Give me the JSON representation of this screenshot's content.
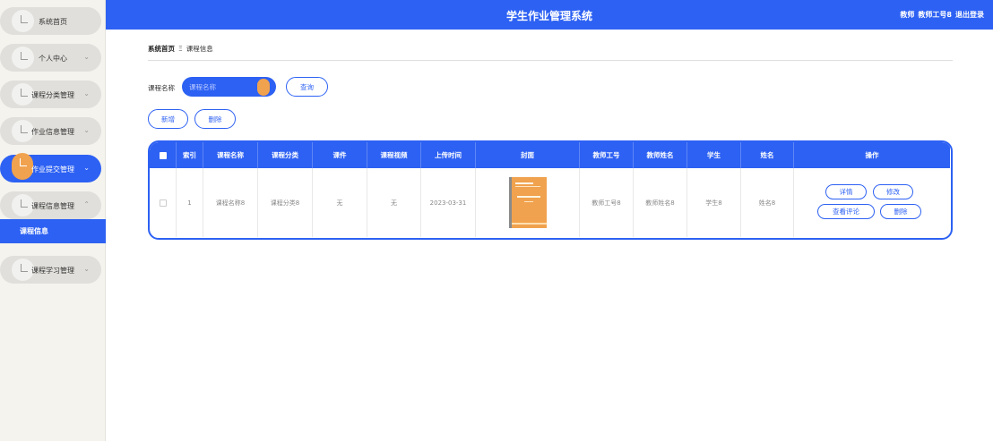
{
  "header": {
    "title": "学生作业管理系统",
    "user_role": "教师",
    "user_name": "教师工号8",
    "logout": "退出登录"
  },
  "sidebar": {
    "items": [
      {
        "label": "系统首页"
      },
      {
        "label": "个人中心"
      },
      {
        "label": "课程分类管理"
      },
      {
        "label": "作业信息管理"
      },
      {
        "label": "作业提交管理"
      },
      {
        "label": "课程信息管理"
      },
      {
        "label": "课程学习管理"
      }
    ],
    "sub_item": "课程信息"
  },
  "breadcrumb": {
    "home": "系统首页",
    "separator": "Ξ",
    "current": "课程信息"
  },
  "search": {
    "label": "课程名称",
    "placeholder": "课程名称",
    "button": "查询"
  },
  "actions": {
    "add": "新增",
    "delete": "删除"
  },
  "table": {
    "headers": [
      "索引",
      "课程名称",
      "课程分类",
      "课件",
      "课程视频",
      "上传时间",
      "封面",
      "教师工号",
      "教师姓名",
      "学生",
      "姓名",
      "操作"
    ],
    "rows": [
      {
        "index": "1",
        "course_name": "课程名称8",
        "category": "课程分类8",
        "courseware": "无",
        "video": "无",
        "upload_time": "2023-03-31",
        "teacher_id": "教师工号8",
        "teacher_name": "教师姓名8",
        "student": "学生8",
        "name": "姓名8",
        "ops": {
          "detail": "详情",
          "edit": "修改",
          "comments": "查看评论",
          "delete": "删除"
        }
      }
    ]
  },
  "colors": {
    "primary": "#2d61f3",
    "accent": "#f0a24e",
    "sidebar_bg": "#f4f3ee"
  }
}
